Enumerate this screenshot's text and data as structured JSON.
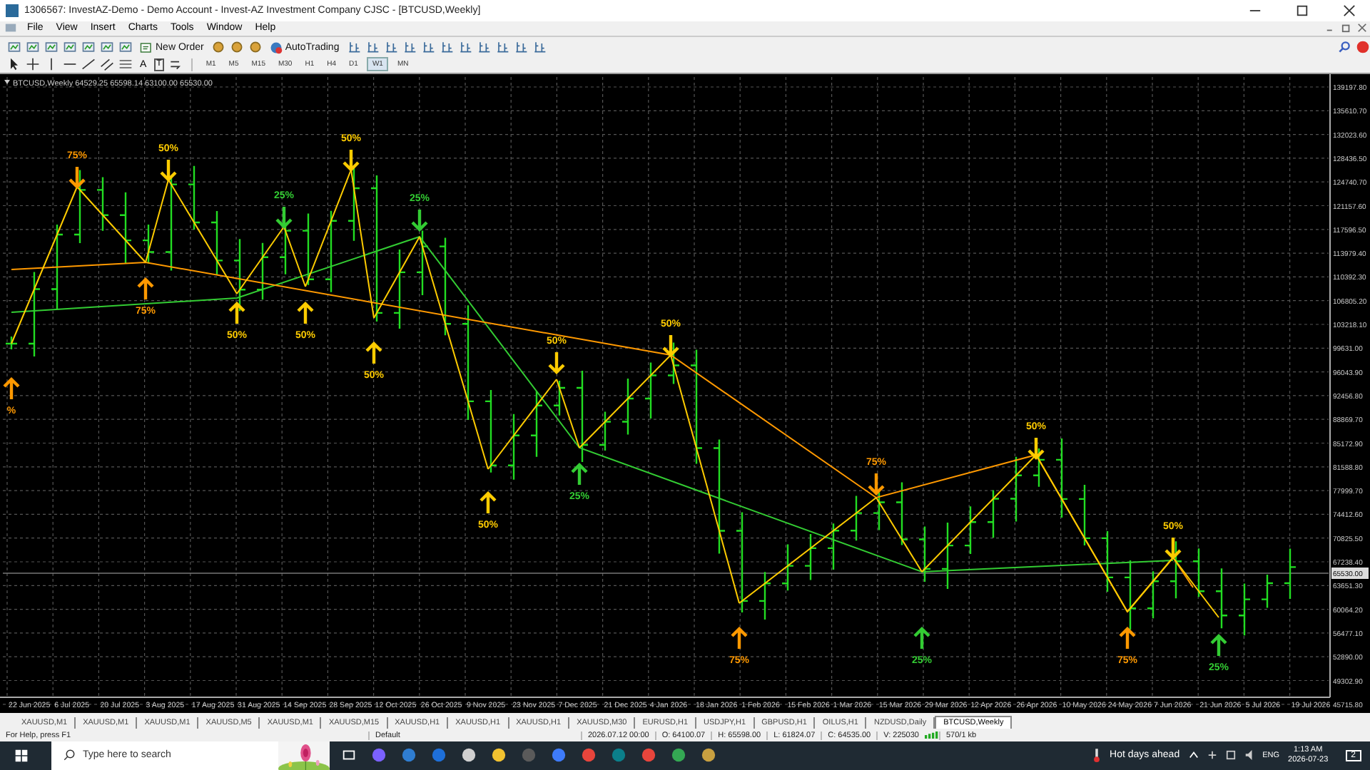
{
  "window": {
    "title": "1306567: InvestAZ-Demo - Demo Account - Invest-AZ Investment Company CJSC - [BTCUSD,Weekly]"
  },
  "menu": [
    "File",
    "View",
    "Insert",
    "Charts",
    "Tools",
    "Window",
    "Help"
  ],
  "toolbar": {
    "new_order": "New Order",
    "auto_trading": "AutoTrading"
  },
  "drawing_tools": {
    "text_tool": "A",
    "label_tool": "T"
  },
  "timeframes": [
    {
      "label": "M1",
      "selected": false
    },
    {
      "label": "M5",
      "selected": false
    },
    {
      "label": "M15",
      "selected": false
    },
    {
      "label": "M30",
      "selected": false
    },
    {
      "label": "H1",
      "selected": false
    },
    {
      "label": "H4",
      "selected": false
    },
    {
      "label": "D1",
      "selected": false
    },
    {
      "label": "W1",
      "selected": true
    },
    {
      "label": "MN",
      "selected": false
    }
  ],
  "chart": {
    "header": "BTCUSD,Weekly  64529.25 65598.14 63100.00 65530.00",
    "price_labels": [
      "139197.80",
      "135610.70",
      "132023.60",
      "128436.50",
      "124740.70",
      "121157.60",
      "117596.50",
      "113979.40",
      "110392.30",
      "106805.20",
      "103218.10",
      "99631.00",
      "96043.90",
      "92456.80",
      "88869.70",
      "85172.90",
      "81588.80",
      "77999.70",
      "74412.60",
      "70825.50",
      "67238.40",
      "63651.30",
      "60064.20",
      "56477.10",
      "52890.00",
      "49302.90",
      "45715.80"
    ],
    "current_price": "65530.00",
    "date_labels": [
      "22 Jun 2025",
      "6 Jul 2025",
      "20 Jul 2025",
      "3 Aug 2025",
      "17 Aug 2025",
      "31 Aug 2025",
      "14 Sep 2025",
      "28 Sep 2025",
      "12 Oct 2025",
      "26 Oct 2025",
      "9 Nov 2025",
      "23 Nov 2025",
      "7 Dec 2025",
      "21 Dec 2025",
      "4 Jan 2026",
      "18 Jan 2026",
      "1 Feb 2026",
      "15 Feb 2026",
      "1 Mar 2026",
      "15 Mar 2026",
      "29 Mar 2026",
      "12 Apr 2026",
      "26 Apr 2026",
      "10 May 2026",
      "24 May 2026",
      "7 Jun 2026",
      "21 Jun 2026",
      "5 Jul 2026",
      "19 Jul 2026"
    ],
    "markers": [
      {
        "label": "%",
        "kind": "up",
        "color": "#ff9900"
      },
      {
        "label": "75%",
        "kind": "down",
        "color": "#ff9900"
      },
      {
        "label": "75%",
        "kind": "up",
        "color": "#ff9900"
      },
      {
        "label": "50%",
        "kind": "down",
        "color": "#ffcc00"
      },
      {
        "label": "50%",
        "kind": "up",
        "color": "#ffcc00"
      },
      {
        "label": "25%",
        "kind": "down",
        "color": "#33cc33"
      },
      {
        "label": "50%",
        "kind": "up",
        "color": "#ffcc00"
      },
      {
        "label": "50%",
        "kind": "down",
        "color": "#ffcc00"
      },
      {
        "label": "50%",
        "kind": "up",
        "color": "#ffcc00"
      },
      {
        "label": "25%",
        "kind": "down",
        "color": "#33cc33"
      },
      {
        "label": "50%",
        "kind": "up",
        "color": "#ffcc00"
      },
      {
        "label": "50%",
        "kind": "down",
        "color": "#ffcc00"
      },
      {
        "label": "25%",
        "kind": "up",
        "color": "#33cc33"
      },
      {
        "label": "50%",
        "kind": "down",
        "color": "#ffcc00"
      },
      {
        "label": "75%",
        "kind": "up",
        "color": "#ff9900"
      },
      {
        "label": "75%",
        "kind": "down",
        "color": "#ff9900"
      },
      {
        "label": "25%",
        "kind": "up",
        "color": "#33cc33"
      },
      {
        "label": "50%",
        "kind": "down",
        "color": "#ffcc00"
      },
      {
        "label": "75%",
        "kind": "up",
        "color": "#ff9900"
      },
      {
        "label": "50%",
        "kind": "down",
        "color": "#ffcc00"
      },
      {
        "label": "25%",
        "kind": "up",
        "color": "#33cc33"
      }
    ]
  },
  "tabs": [
    {
      "label": "XAUUSD,M1",
      "selected": false
    },
    {
      "label": "XAUUSD,M1",
      "selected": false
    },
    {
      "label": "XAUUSD,M1",
      "selected": false
    },
    {
      "label": "XAUUSD,M5",
      "selected": false
    },
    {
      "label": "XAUUSD,M1",
      "selected": false
    },
    {
      "label": "XAUUSD,M15",
      "selected": false
    },
    {
      "label": "XAUUSD,H1",
      "selected": false
    },
    {
      "label": "XAUUSD,H1",
      "selected": false
    },
    {
      "label": "XAUUSD,H1",
      "selected": false
    },
    {
      "label": "XAUUSD,M30",
      "selected": false
    },
    {
      "label": "EURUSD,H1",
      "selected": false
    },
    {
      "label": "USDJPY,H1",
      "selected": false
    },
    {
      "label": "GBPUSD,H1",
      "selected": false
    },
    {
      "label": "OILUS,H1",
      "selected": false
    },
    {
      "label": "NZDUSD,Daily",
      "selected": false
    },
    {
      "label": "BTCUSD,Weekly",
      "selected": true
    }
  ],
  "status_bar": {
    "help": "For Help, press F1",
    "profile": "Default",
    "time": "2026.07.12 00:00",
    "open": "O: 64100.07",
    "high": "H: 65598.00",
    "low": "L: 61824.07",
    "close": "C: 64535.00",
    "volume": "V: 225030",
    "traffic": "570/1 kb"
  },
  "taskbar": {
    "search_placeholder": "Type here to search",
    "weather": "Hot days ahead",
    "language": "ENG",
    "time": "1:13 AM",
    "date": "2026-07-23",
    "notifications": "2"
  }
}
